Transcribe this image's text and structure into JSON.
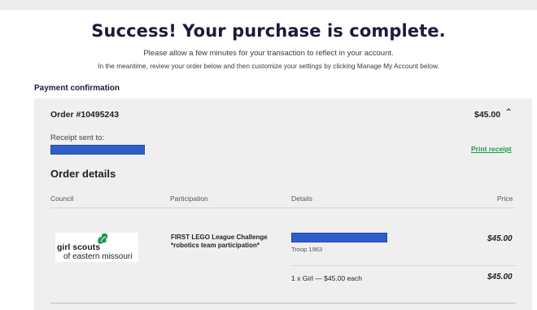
{
  "header": {
    "headline": "Success! Your purchase is complete.",
    "subline_1": "Please allow a few minutes for your transaction to reflect in your account.",
    "subline_2": "In the meantime, review your order below and then customize your settings by clicking Manage My Account below."
  },
  "payment": {
    "section_title": "Payment confirmation",
    "order_number": "Order #10495243",
    "total": "$45.00",
    "collapse_icon": "chevron-up-icon",
    "receipt_label": "Receipt sent to:",
    "print_receipt": "Print receipt"
  },
  "order_details": {
    "title": "Order details",
    "columns": [
      "Council",
      "Participation",
      "Details",
      "Price"
    ],
    "item": {
      "council_logo_text": "girl scouts",
      "council_logo_sub": "of eastern missouri",
      "participation": "FIRST LEGO League Challenge *robotics team participation*",
      "troop": "Troop 1963",
      "price": "$45.00",
      "line_item": "1 x Girl — $45.00 each",
      "line_price": "$45.00"
    }
  },
  "colors": {
    "accent_green": "#1a9b4a",
    "redaction_blue": "#2e5fc8",
    "panel_bg": "#efefef",
    "headline_navy": "#1b1b3a"
  }
}
